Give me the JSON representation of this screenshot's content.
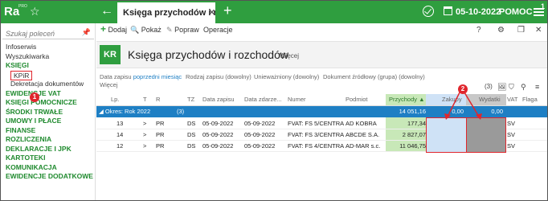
{
  "app": {
    "logo": "Ra",
    "logo_sub": "PRO",
    "tab_title": "Księga przychodów i rozcho",
    "date": "05-10-2022",
    "help": "POMOC",
    "window_badge": "1"
  },
  "sidebar": {
    "search_placeholder": "Szukaj poleceń",
    "items": [
      {
        "label": "Infoserwis",
        "kind": "plain"
      },
      {
        "label": "Wyszukiwarka",
        "kind": "plain"
      },
      {
        "label": "KSIĘGI",
        "kind": "cat"
      },
      {
        "label": "KPiR",
        "kind": "sel"
      },
      {
        "label": "Dekretacja dokumentów",
        "kind": "sub"
      },
      {
        "label": "EWIDENCJE VAT",
        "kind": "cat"
      },
      {
        "label": "KSIĘGI POMOCNICZE",
        "kind": "cat"
      },
      {
        "label": "ŚRODKI TRWAŁE",
        "kind": "cat"
      },
      {
        "label": "UMOWY I PŁACE",
        "kind": "cat"
      },
      {
        "label": "FINANSE",
        "kind": "cat"
      },
      {
        "label": "ROZLICZENIA",
        "kind": "cat"
      },
      {
        "label": "DEKLARACJE I JPK",
        "kind": "cat"
      },
      {
        "label": "KARTOTEKI",
        "kind": "cat"
      },
      {
        "label": "KOMUNIKACJA",
        "kind": "cat"
      },
      {
        "label": "EWIDENCJE DODATKOWE",
        "kind": "cat"
      }
    ],
    "callout": "1"
  },
  "toolbar": {
    "add": "Dodaj",
    "show": "Pokaż",
    "edit": "Popraw",
    "ops": "Operacje"
  },
  "header": {
    "badge": "KR",
    "title": "Księga przychodów i rozchodów",
    "more": "Więcej"
  },
  "filters": {
    "date_label": "Data zapisu",
    "date_value": "poprzedni miesiąc",
    "kind": "Rodzaj zapisu (dowolny)",
    "void": "Unieważniony (dowolny)",
    "source": "Dokument źródłowy (grupa) (dowolny)",
    "more": "Więcej",
    "count": "(3)"
  },
  "grid": {
    "columns": [
      "Lp.",
      "T",
      "R",
      "TZ",
      "Data zapisu",
      "Data zdarze...",
      "Numer",
      "Podmiot",
      "Przychody",
      "Zakupy",
      "Wydatki",
      "VAT",
      "Flaga"
    ],
    "group": {
      "label": "Okres: Rok 2022",
      "count": "(3)",
      "income": "14 051,16",
      "purchases": "0,00",
      "expenses": "0,00"
    },
    "rows": [
      {
        "lp": "13",
        "t": ">",
        "r": "PR",
        "tz": "DS",
        "date": "05-09-2022",
        "event": "05-09-2022",
        "number": "FVAT: FS 5/CENTRA...",
        "party": "AD KOBRA",
        "income": "177,34",
        "vat": "SV"
      },
      {
        "lp": "14",
        "t": ">",
        "r": "PR",
        "tz": "DS",
        "date": "05-09-2022",
        "event": "05-09-2022",
        "number": "FVAT: FS 3/CENTRA...",
        "party": "ABCDE S.A.",
        "income": "2 827,07",
        "vat": "SV"
      },
      {
        "lp": "12",
        "t": ">",
        "r": "PR",
        "tz": "DS",
        "date": "05-09-2022",
        "event": "05-09-2022",
        "number": "FVAT: FS 4/CENTRA...",
        "party": "AD-MAR s.c.",
        "income": "11 046,75",
        "vat": "SV"
      }
    ],
    "callout": "2"
  },
  "colors": {
    "brand": "#2f9e3f",
    "selection": "#1e7fc4",
    "annotation": "#e0262d"
  }
}
